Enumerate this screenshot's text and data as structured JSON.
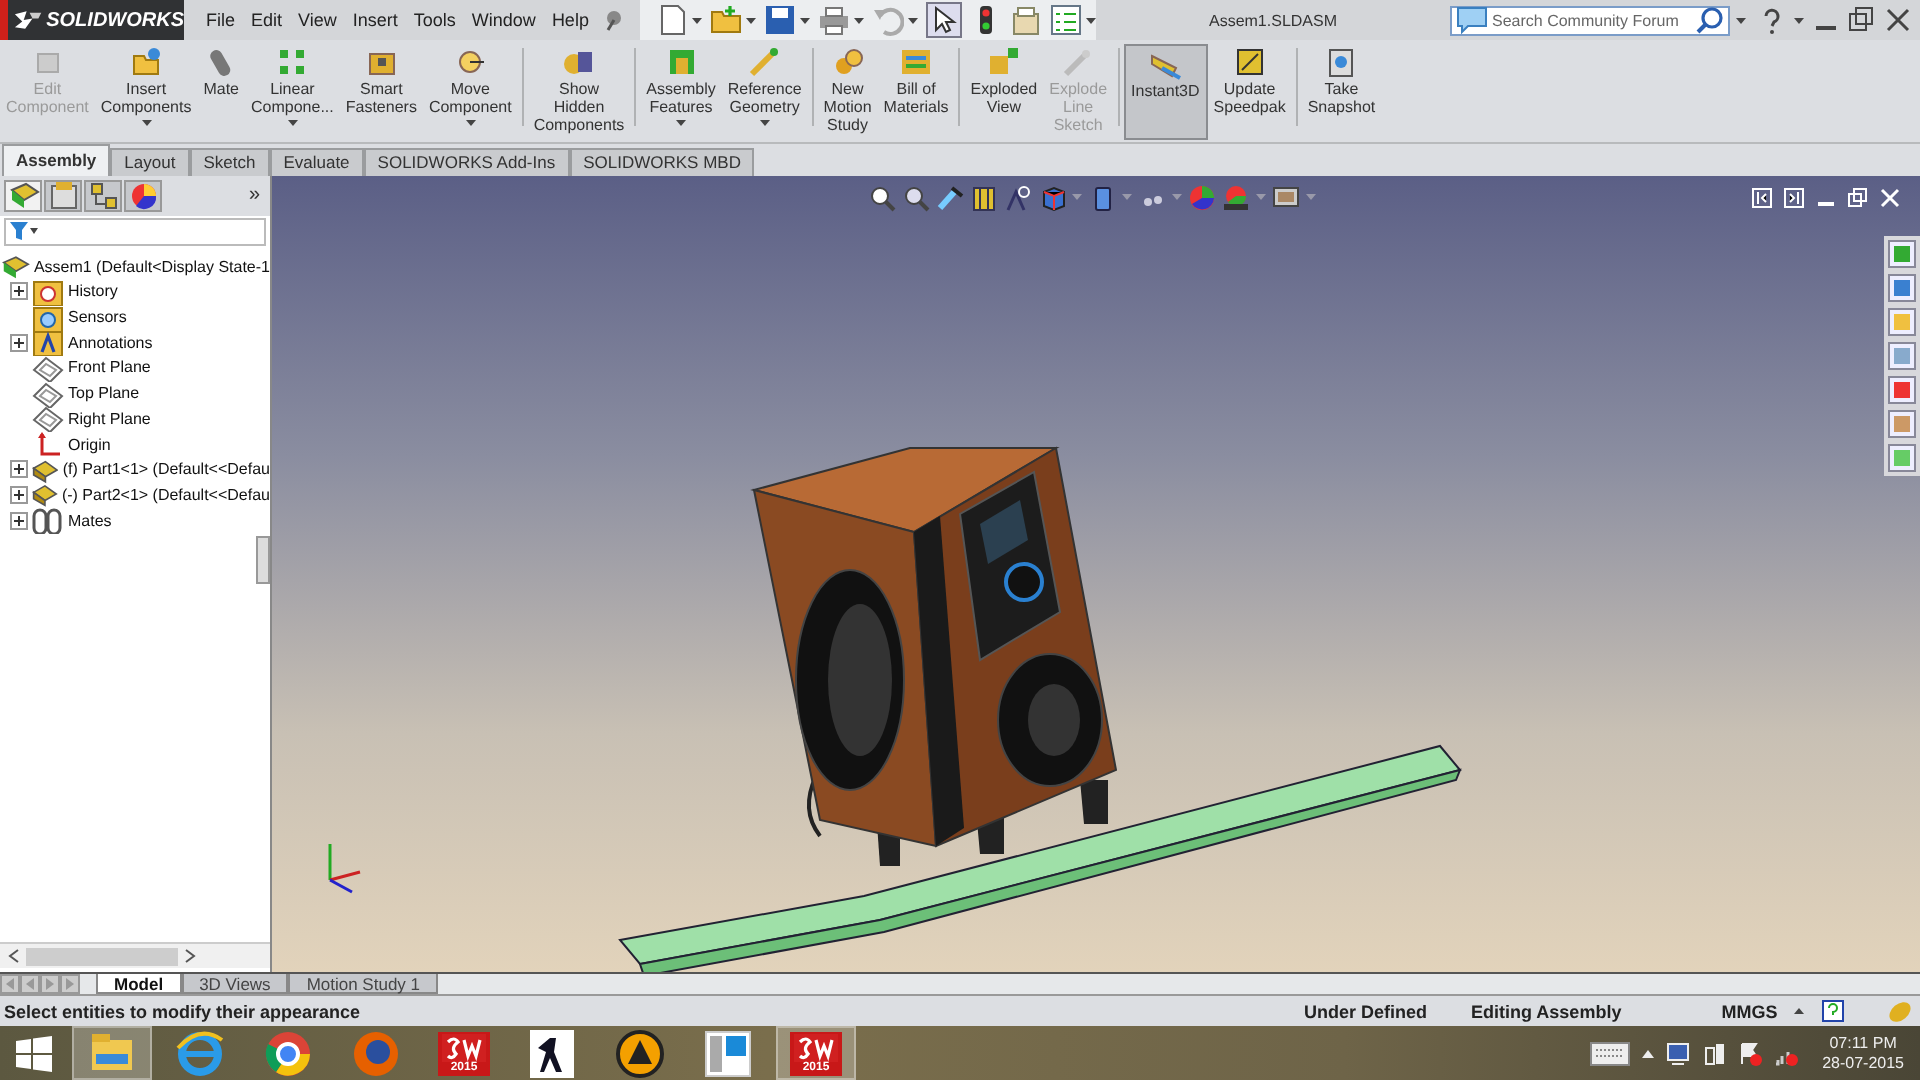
{
  "title_bar": {
    "logo": "SOLIDWORKS",
    "menu": [
      "File",
      "Edit",
      "View",
      "Insert",
      "Tools",
      "Window",
      "Help"
    ],
    "document_title": "Assem1.SLDASM",
    "search": {
      "placeholder": "Search Community Forum"
    }
  },
  "ribbon": {
    "groups": [
      {
        "buttons": [
          {
            "kind": "edit",
            "label": [
              "Edit",
              "Component"
            ],
            "disabled": true,
            "selected": false,
            "dropdown": false
          },
          {
            "kind": "insert",
            "label": [
              "Insert",
              "Components"
            ],
            "disabled": false,
            "selected": false,
            "dropdown": true
          },
          {
            "kind": "mate",
            "label": [
              "Mate"
            ],
            "disabled": false,
            "selected": false,
            "dropdown": false
          },
          {
            "kind": "pattern",
            "label": [
              "Linear",
              "Compone..."
            ],
            "disabled": false,
            "selected": false,
            "dropdown": true
          },
          {
            "kind": "fastener",
            "label": [
              "Smart",
              "Fasteners"
            ],
            "disabled": false,
            "selected": false,
            "dropdown": false
          },
          {
            "kind": "move",
            "label": [
              "Move",
              "Component"
            ],
            "disabled": false,
            "selected": false,
            "dropdown": true
          }
        ]
      },
      {
        "buttons": [
          {
            "kind": "show",
            "label": [
              "Show",
              "Hidden",
              "Components"
            ],
            "disabled": false,
            "selected": false,
            "dropdown": false
          }
        ]
      },
      {
        "buttons": [
          {
            "kind": "feature",
            "label": [
              "Assembly",
              "Features"
            ],
            "disabled": false,
            "selected": false,
            "dropdown": true
          },
          {
            "kind": "geometry",
            "label": [
              "Reference",
              "Geometry"
            ],
            "disabled": false,
            "selected": false,
            "dropdown": true
          }
        ]
      },
      {
        "buttons": [
          {
            "kind": "motion",
            "label": [
              "New",
              "Motion",
              "Study"
            ],
            "disabled": false,
            "selected": false,
            "dropdown": false
          },
          {
            "kind": "bom",
            "label": [
              "Bill of",
              "Materials"
            ],
            "disabled": false,
            "selected": false,
            "dropdown": false
          }
        ]
      },
      {
        "buttons": [
          {
            "kind": "explode",
            "label": [
              "Exploded",
              "View"
            ],
            "disabled": false,
            "selected": false,
            "dropdown": false
          },
          {
            "kind": "sketch",
            "label": [
              "Explode",
              "Line",
              "Sketch"
            ],
            "disabled": true,
            "selected": false,
            "dropdown": false
          }
        ]
      },
      {
        "buttons": [
          {
            "kind": "instant",
            "label": [
              "Instant3D"
            ],
            "disabled": false,
            "selected": true,
            "dropdown": false
          },
          {
            "kind": "speedpak",
            "label": [
              "Update",
              "Speedpak"
            ],
            "disabled": false,
            "selected": false,
            "dropdown": false
          }
        ]
      },
      {
        "buttons": [
          {
            "kind": "snapshot",
            "label": [
              "Take",
              "Snapshot"
            ],
            "disabled": false,
            "selected": false,
            "dropdown": false
          }
        ]
      }
    ]
  },
  "command_tabs": [
    {
      "label": "Assembly",
      "selected": true
    },
    {
      "label": "Layout",
      "selected": false
    },
    {
      "label": "Sketch",
      "selected": false
    },
    {
      "label": "Evaluate",
      "selected": false
    },
    {
      "label": "SOLIDWORKS Add-Ins",
      "selected": false
    },
    {
      "label": "SOLIDWORKS MBD",
      "selected": false
    }
  ],
  "feature_tree": {
    "panel_tabs": [
      {
        "selected": true
      },
      {
        "selected": false
      },
      {
        "selected": false
      },
      {
        "selected": false
      }
    ],
    "more": "»",
    "root": {
      "kind": "assembly",
      "label": "Assem1  (Default<Display State-1",
      "children": [
        {
          "kind": "history",
          "label": "History",
          "expandable": true
        },
        {
          "kind": "sensor",
          "label": "Sensors",
          "expandable": false
        },
        {
          "kind": "annotation",
          "label": "Annotations",
          "expandable": true
        },
        {
          "kind": "plane",
          "label": "Front Plane",
          "expandable": false
        },
        {
          "kind": "plane",
          "label": "Top Plane",
          "expandable": false
        },
        {
          "kind": "plane",
          "label": "Right Plane",
          "expandable": false
        },
        {
          "kind": "origin",
          "label": "Origin",
          "expandable": false
        },
        {
          "kind": "part",
          "label": "(f) Part1<1>  (Default<<Defau",
          "expandable": true
        },
        {
          "kind": "part",
          "label": "(-) Part2<1>  (Default<<Defau",
          "expandable": true
        },
        {
          "kind": "mates",
          "label": "Mates",
          "expandable": true
        }
      ]
    }
  },
  "bottom_tabs": [
    {
      "label": "Model",
      "selected": true
    },
    {
      "label": "3D Views",
      "selected": false
    },
    {
      "label": "Motion Study 1",
      "selected": false
    }
  ],
  "status_bar": {
    "message": "Select entities to modify their appearance",
    "state": "Under Defined",
    "mode": "Editing Assembly",
    "units": "MMGS"
  },
  "taskbar": {
    "apps": [
      {
        "kind": "explorer",
        "selected": true
      },
      {
        "kind": "ie",
        "selected": false
      },
      {
        "kind": "chrome",
        "selected": false
      },
      {
        "kind": "firefox",
        "selected": false
      },
      {
        "kind": "sw",
        "badge": "2015",
        "selected": false
      },
      {
        "kind": "game",
        "selected": false
      },
      {
        "kind": "player",
        "selected": false
      },
      {
        "kind": "window",
        "selected": false
      },
      {
        "kind": "sw",
        "badge": "2015",
        "selected": true
      }
    ],
    "time": "07:11 PM",
    "date": "28-07-2015"
  }
}
